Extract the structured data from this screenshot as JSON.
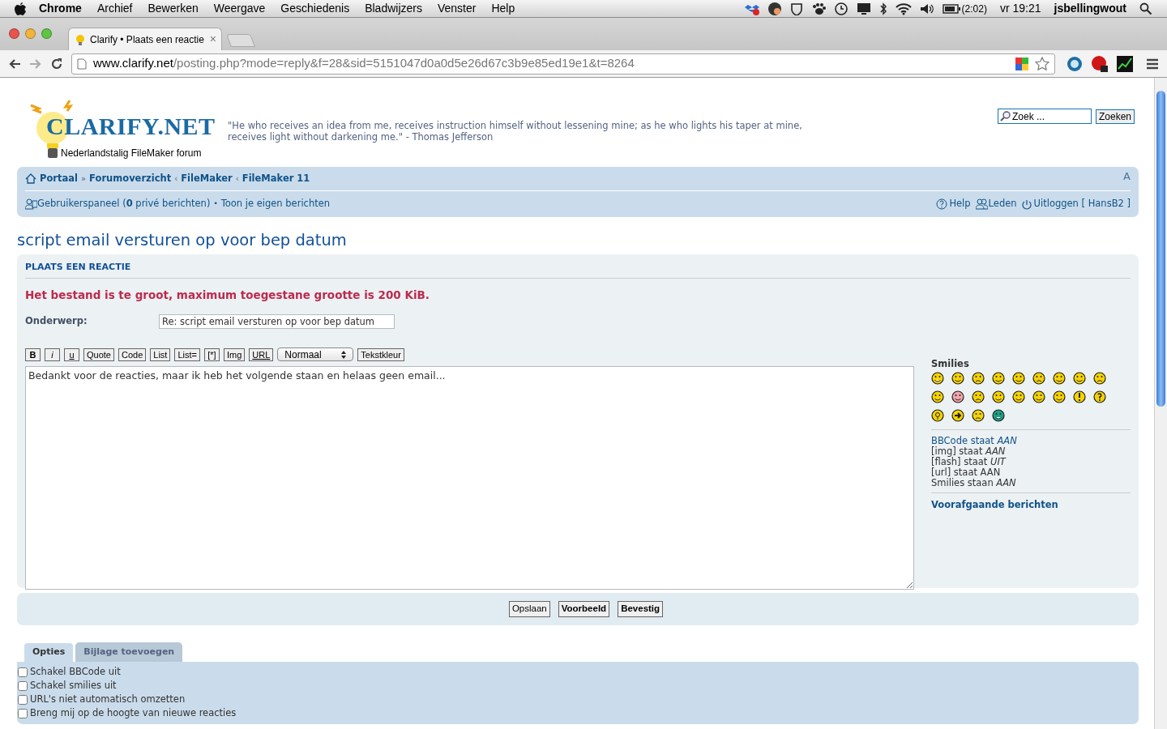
{
  "menubar": {
    "app": "Chrome",
    "menus": [
      "Archief",
      "Bewerken",
      "Weergave",
      "Geschiedenis",
      "Bladwijzers",
      "Venster",
      "Help"
    ],
    "battery": "(2:02)",
    "clock": "vr 19:21",
    "user": "jsbellingwout"
  },
  "browser": {
    "tab_title": "Clarify • Plaats een reactie",
    "tab_close": "×",
    "url_host": "www.clarify.net",
    "url_path": "/posting.php?mode=reply&f=28&sid=5151047d0a0d5e26d67c3b9e85ed19e1&t=8264"
  },
  "header": {
    "logo_title": "CLARIFY.NET",
    "logo_subtitle": "Nederlandstalig FileMaker forum",
    "quote": "\"He who receives an idea from me, receives instruction himself without lessening mine; as he who lights his taper at mine, receives light without darkening me.\" - Thomas Jefferson",
    "search_placeholder": "Zoek ...",
    "search_button": "Zoeken"
  },
  "breadcrumbs": [
    {
      "label": "Portaal"
    },
    {
      "label": "Forumoverzicht",
      "sep": "»"
    },
    {
      "label": "FileMaker",
      "sep": "‹"
    },
    {
      "label": "FileMaker 11",
      "sep": "‹"
    }
  ],
  "font_size_toggle": "A",
  "user_links": {
    "panel": "Gebruikerspaneel",
    "open": "(",
    "count": "0",
    "close": "privé berichten)",
    "sep": "•",
    "own_posts": "Toon je eigen berichten",
    "help": "Help",
    "members": "Leden",
    "logout": "Uitloggen [ HansB2 ]"
  },
  "topic_title": "script email versturen op voor bep datum",
  "form": {
    "heading": "PLAATS EEN REACTIE",
    "error": "Het bestand is te groot, maximum toegestane grootte is 200 KiB.",
    "subject_label": "Onderwerp:",
    "subject_value": "Re: script email versturen op voor bep datum",
    "toolbar": [
      {
        "label": "B",
        "kind": "bold"
      },
      {
        "label": "i",
        "kind": "italic"
      },
      {
        "label": "u",
        "kind": "underline"
      },
      {
        "label": "Quote",
        "kind": "plain"
      },
      {
        "label": "Code",
        "kind": "plain"
      },
      {
        "label": "List",
        "kind": "plain"
      },
      {
        "label": "List=",
        "kind": "plain"
      },
      {
        "label": "[*]",
        "kind": "plain"
      },
      {
        "label": "Img",
        "kind": "plain"
      },
      {
        "label": "URL",
        "kind": "underline"
      },
      {
        "label": "Normaal",
        "kind": "select"
      },
      {
        "label": "Tekstkleur",
        "kind": "plain"
      }
    ],
    "message": "Bedankt voor de reacties, maar ik heb het volgende staan en helaas geen email...",
    "smilies_title": "Smilies",
    "status_lines": [
      {
        "text": "BBCode staat *AAN*",
        "kind": "link"
      },
      {
        "text": "[img] staat *AAN*",
        "kind": "plain"
      },
      {
        "text": "[flash] staat *UIT*",
        "kind": "plain"
      },
      {
        "text": "[url] staat AAN",
        "kind": "plain"
      },
      {
        "text": "Smilies staan *AAN*",
        "kind": "plain"
      }
    ],
    "previous_posts": "Voorafgaande berichten"
  },
  "buttons": [
    {
      "label": "Opslaan",
      "kind": "normal"
    },
    {
      "label": "Voorbeeld",
      "kind": "bold"
    },
    {
      "label": "Bevestig",
      "kind": "bold"
    }
  ],
  "tabs": [
    {
      "label": "Opties",
      "selected": true
    },
    {
      "label": "Bijlage toevoegen",
      "selected": false
    }
  ],
  "options": [
    {
      "label": "Schakel BBCode uit",
      "checked": false
    },
    {
      "label": "Schakel smilies uit",
      "checked": false
    },
    {
      "label": "URL's niet automatisch omzetten",
      "checked": false
    },
    {
      "label": "Breng mij op de hoogte van nieuwe reacties",
      "checked": false
    }
  ]
}
